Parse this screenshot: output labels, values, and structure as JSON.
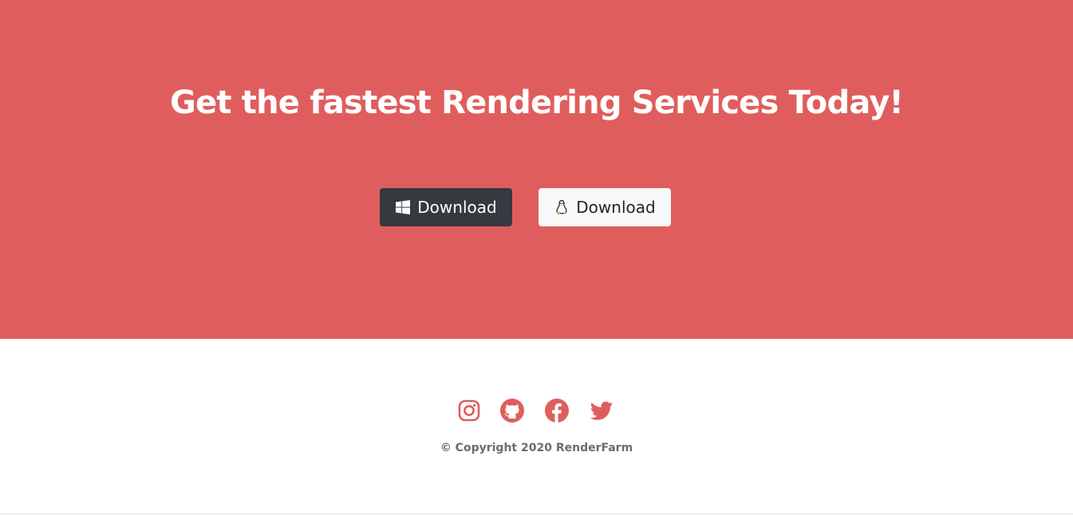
{
  "hero": {
    "title": "Get the fastest Rendering Services Today!",
    "background_color": "#df5e5d",
    "buttons": [
      {
        "label": "Download",
        "icon": "windows-icon",
        "style": "dark"
      },
      {
        "label": "Download",
        "icon": "linux-icon",
        "style": "light"
      }
    ]
  },
  "footer": {
    "social_icons": [
      "instagram-icon",
      "github-icon",
      "facebook-icon",
      "twitter-icon"
    ],
    "icon_color": "#df5e5d",
    "copyright": "© Copyright 2020 RenderFarm"
  }
}
